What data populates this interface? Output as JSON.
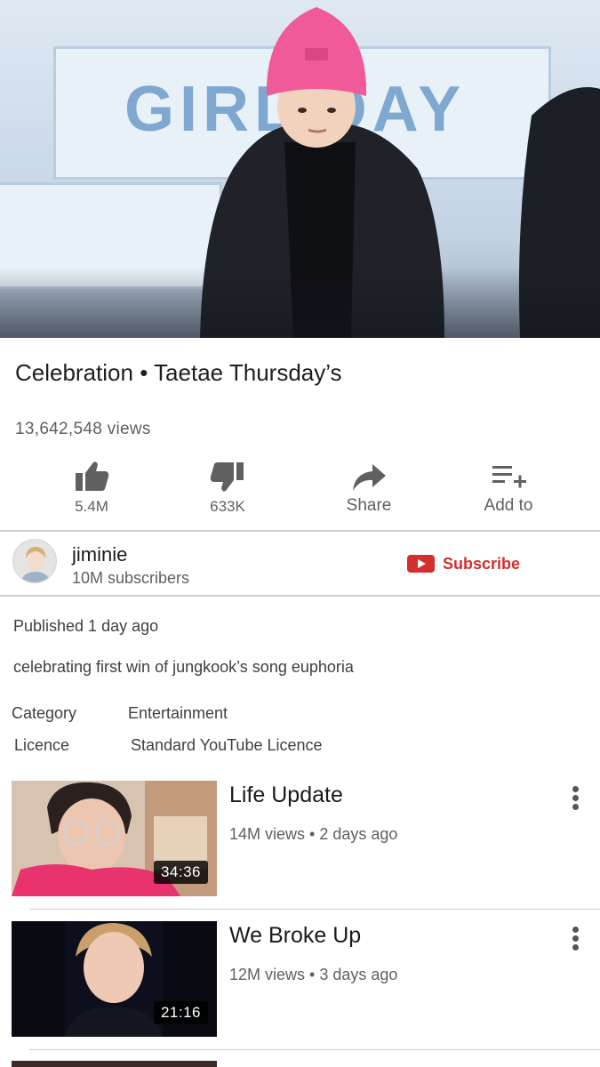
{
  "video": {
    "title": "Celebration • Taetae Thursday’s",
    "views": "13,642,548 views",
    "banner_text": "GIRL DAY"
  },
  "actions": {
    "like_count": "5.4M",
    "dislike_count": "633K",
    "share_label": "Share",
    "add_label": "Add to",
    "icons": [
      "thumbs-up-icon",
      "thumbs-down-icon",
      "share-arrow-icon",
      "playlist-add-icon"
    ]
  },
  "channel": {
    "name": "jiminie",
    "subscribers": "10M subscribers",
    "subscribe_label": "Subscribe"
  },
  "details": {
    "published": "Published 1 day ago",
    "description": "celebrating first win of jungkook’s song euphoria",
    "category_key": "Category",
    "category_value": "Entertainment",
    "licence_key": "Licence",
    "licence_value": "Standard YouTube Licence"
  },
  "related": [
    {
      "title": "Life Update",
      "meta": "14M views • 2 days ago",
      "duration": "34:36"
    },
    {
      "title": "We Broke Up",
      "meta": "12M views • 3 days ago",
      "duration": "21:16"
    }
  ],
  "colors": {
    "subscribe_red": "#d32f2f",
    "icon_gray": "#606060",
    "divider": "#cfcfcf"
  }
}
